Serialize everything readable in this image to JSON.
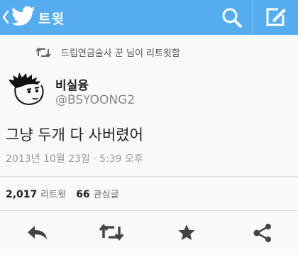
{
  "header": {
    "title": "트윗",
    "back_icon": "chevron-left-icon",
    "logo_icon": "twitter-bird-icon",
    "search_icon": "search-icon",
    "compose_icon": "compose-icon",
    "bar_color": "#55acee"
  },
  "retweet_note": {
    "icon": "retweet-icon",
    "text": "드립연금술사 꾼 님이 리트윗함"
  },
  "tweet": {
    "display_name": "비실융",
    "handle": "@BSYOONG2",
    "text": "그냥 두개 다 사버렸어",
    "timestamp": "2013년 10월 23일 · 5:39 오후"
  },
  "stats": {
    "retweets_count": "2,017",
    "retweets_label": "리트윗",
    "favorites_count": "66",
    "favorites_label": "관심글"
  },
  "actions": [
    {
      "icon": "reply-icon"
    },
    {
      "icon": "retweet-icon"
    },
    {
      "icon": "star-icon"
    },
    {
      "icon": "share-icon"
    }
  ]
}
